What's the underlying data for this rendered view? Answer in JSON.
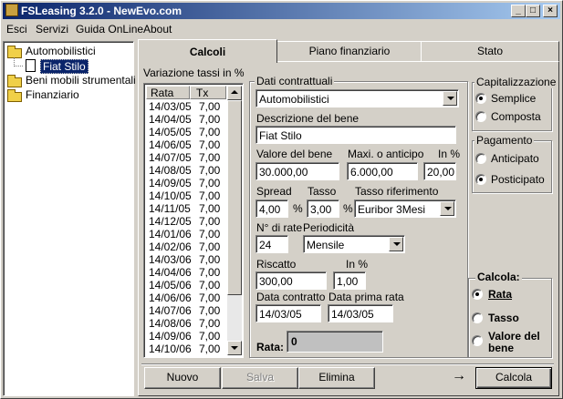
{
  "window": {
    "title": "FSLeasing 3.2.0 - NewEvo.com"
  },
  "menu": [
    "Esci",
    "Servizi",
    "Guida OnLine",
    "About"
  ],
  "tree": {
    "root1": "Automobilistici",
    "child1": "Fiat Stilo",
    "root2": "Beni mobili strumentali",
    "root3": "Finanziario"
  },
  "tabs": [
    "Calcoli",
    "Piano finanziario",
    "Stato"
  ],
  "rates": {
    "title": "Variazione tassi in %",
    "col_rata": "Rata",
    "col_tx": "Tx",
    "rows": [
      [
        "14/03/05",
        "7,00"
      ],
      [
        "14/04/05",
        "7,00"
      ],
      [
        "14/05/05",
        "7,00"
      ],
      [
        "14/06/05",
        "7,00"
      ],
      [
        "14/07/05",
        "7,00"
      ],
      [
        "14/08/05",
        "7,00"
      ],
      [
        "14/09/05",
        "7,00"
      ],
      [
        "14/10/05",
        "7,00"
      ],
      [
        "14/11/05",
        "7,00"
      ],
      [
        "14/12/05",
        "7,00"
      ],
      [
        "14/01/06",
        "7,00"
      ],
      [
        "14/02/06",
        "7,00"
      ],
      [
        "14/03/06",
        "7,00"
      ],
      [
        "14/04/06",
        "7,00"
      ],
      [
        "14/05/06",
        "7,00"
      ],
      [
        "14/06/06",
        "7,00"
      ],
      [
        "14/07/06",
        "7,00"
      ],
      [
        "14/08/06",
        "7,00"
      ],
      [
        "14/09/06",
        "7,00"
      ],
      [
        "14/10/06",
        "7,00"
      ]
    ]
  },
  "contract": {
    "title": "Dati contrattuali",
    "category": "Automobilistici",
    "descr_label": "Descrizione del bene",
    "descr_value": "Fiat Stilo",
    "valore_label": "Valore del bene",
    "valore_value": "30.000,00",
    "anticipo_label": "Maxi. o anticipo",
    "anticipo_value": "6.000,00",
    "inpct_label": "In %",
    "inpct_value": "20,00",
    "spread_label": "Spread",
    "spread_value": "4,00",
    "pct_sign": "%",
    "tasso_label": "Tasso",
    "tasso_value": "3,00",
    "rif_label": "Tasso riferimento",
    "rif_value": "Euribor 3Mesi",
    "nrate_label": "N° di rate",
    "nrate_value": "24",
    "period_label": "Periodicità",
    "period_value": "Mensile",
    "riscatto_label": "Riscatto",
    "riscatto_value": "300,00",
    "riscatto_pct_label": "In %",
    "riscatto_pct_value": "1,00",
    "data_contratto_label": "Data contratto",
    "data_contratto_value": "14/03/05",
    "data_prima_label": "Data prima rata",
    "data_prima_value": "14/03/05",
    "rata_label": "Rata:",
    "rata_value": "0"
  },
  "capitalizzazione": {
    "title": "Capitalizzazione",
    "opt1": "Semplice",
    "opt2": "Composta"
  },
  "pagamento": {
    "title": "Pagamento",
    "opt1": "Anticipato",
    "opt2": "Posticipato"
  },
  "calcola": {
    "title": "Calcola:",
    "opt1": "Rata",
    "opt2": "Tasso",
    "opt3a": "Valore del",
    "opt3b": "bene"
  },
  "buttons": {
    "nuovo": "Nuovo",
    "salva": "Salva",
    "elimina": "Elimina",
    "calcola": "Calcola",
    "arrow": "→"
  }
}
